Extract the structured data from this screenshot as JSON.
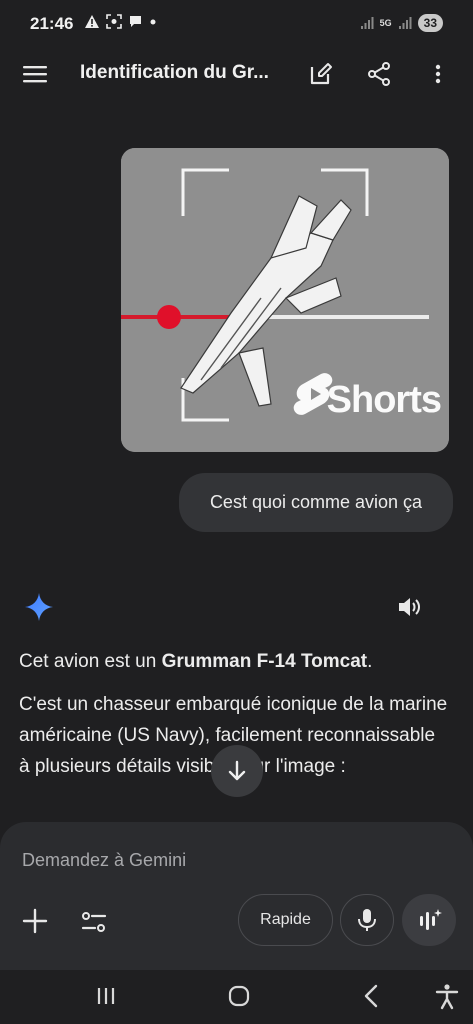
{
  "status_bar": {
    "time": "21:46",
    "network": "5G",
    "battery": "33"
  },
  "header": {
    "title": "Identification du Gr..."
  },
  "attachment": {
    "overlay_text": "Shorts"
  },
  "user_message": "Cest quoi comme avion ça",
  "response": {
    "p1_prefix": "Cet avion est un ",
    "p1_bold": "Grumman F-14 Tomcat",
    "p1_suffix": ".",
    "p2": "C'est un chasseur embarqué iconique de la marine américaine (US Navy), facilement reconnaissable à plusieurs détails visibles sur l'image :"
  },
  "composer": {
    "placeholder": "Demandez à Gemini",
    "mode_label": "Rapide"
  },
  "colors": {
    "background": "#1f1f21",
    "bubble": "#333437",
    "composer": "#2b2c2f",
    "gemini_blue": "#4a8cff",
    "crosshair_red": "#e0102a"
  },
  "icons": [
    "menu-icon",
    "edit-icon",
    "share-icon",
    "more-icon",
    "gemini-spark-icon",
    "speaker-icon",
    "arrow-down-icon",
    "plus-icon",
    "tune-icon",
    "mic-icon",
    "live-icon",
    "recents-icon",
    "home-icon",
    "back-icon",
    "accessibility-icon"
  ]
}
